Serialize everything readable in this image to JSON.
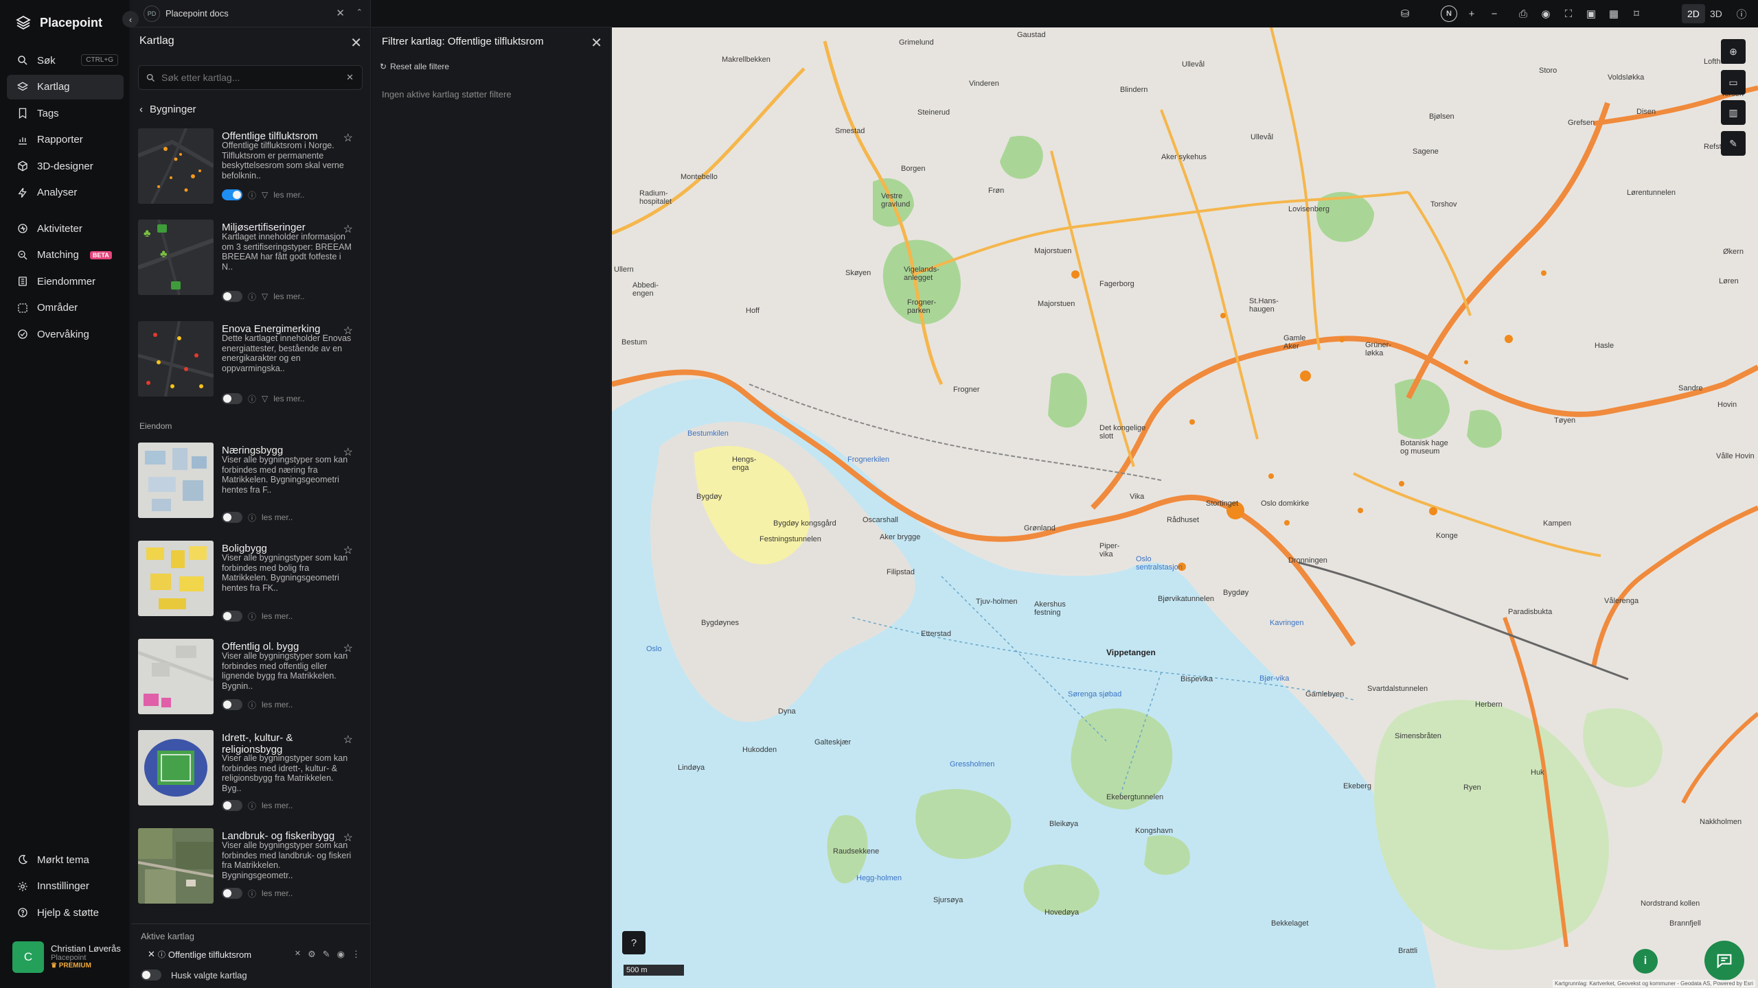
{
  "app": {
    "name": "Placepoint"
  },
  "nav": {
    "items": [
      {
        "label": "Søk",
        "icon": "search-icon",
        "shortcut": "CTRL+G"
      },
      {
        "label": "Kartlag",
        "icon": "layers-icon",
        "active": true
      },
      {
        "label": "Tags",
        "icon": "bookmark-icon"
      },
      {
        "label": "Rapporter",
        "icon": "bar-chart-icon"
      },
      {
        "label": "3D-designer",
        "icon": "cube-icon"
      },
      {
        "label": "Analyser",
        "icon": "bolt-icon"
      }
    ],
    "items2": [
      {
        "label": "Aktiviteter",
        "icon": "activity-icon"
      },
      {
        "label": "Matching",
        "icon": "match-icon",
        "badge": "BETA"
      },
      {
        "label": "Eiendommer",
        "icon": "building-icon"
      },
      {
        "label": "Områder",
        "icon": "area-icon"
      },
      {
        "label": "Overvåking",
        "icon": "monitor-icon"
      }
    ],
    "bottom": [
      {
        "label": "Mørkt tema",
        "icon": "moon-icon"
      },
      {
        "label": "Innstillinger",
        "icon": "gear-icon"
      },
      {
        "label": "Hjelp & støtte",
        "icon": "help-icon"
      }
    ]
  },
  "user": {
    "initial": "C",
    "name": "Christian Løverås",
    "org": "Placepoint",
    "plan": "PREMIUM"
  },
  "doc": {
    "badge": "PD",
    "name": "Placepoint docs"
  },
  "layers": {
    "title": "Kartlag",
    "search_placeholder": "Søk etter kartlag...",
    "back_label": "Bygninger",
    "section_eiendom": "Eiendom",
    "more_label": "les mer..",
    "cards": [
      {
        "title": "Offentlige tilfluktsrom",
        "desc": "Offentlige tilfluktsrom i Norge. Tilfluktsrom er permanente beskyttelsesrom som skal verne befolknin..",
        "enabled": true
      },
      {
        "title": "Miljøsertifiseringer",
        "desc": "Kartlaget inneholder informasjon om 3 sertifiseringstyper: BREEAM BREEAM har fått godt fotfeste i N..",
        "enabled": false
      },
      {
        "title": "Enova Energimerking",
        "desc": "Dette kartlaget inneholder Enovas energiattester, bestående av en energikarakter og en oppvarmingska..",
        "enabled": false
      },
      {
        "title": "Næringsbygg",
        "desc": "Viser alle bygningstyper som kan forbindes med næring fra Matrikkelen. Bygningsgeometri hentes fra F..",
        "enabled": false
      },
      {
        "title": "Boligbygg",
        "desc": "Viser alle bygningstyper som kan forbindes med bolig fra Matrikkelen. Bygningsgeometri hentes fra FK..",
        "enabled": false
      },
      {
        "title": "Offentlig ol. bygg",
        "desc": "Viser alle bygningstyper som kan forbindes med offentlig eller lignende bygg fra Matrikkelen. Bygnin..",
        "enabled": false
      },
      {
        "title": "Idrett-, kultur- & religionsbygg",
        "desc": "Viser alle bygningstyper som kan forbindes med idrett-, kultur- & religionsbygg fra Matrikkelen. Byg..",
        "enabled": false
      },
      {
        "title": "Landbruk- og fiskeribygg",
        "desc": "Viser alle bygningstyper som kan forbindes med landbruk- og fiskeri fra Matrikkelen. Bygningsgeometr..",
        "enabled": false
      }
    ],
    "active_title": "Aktive kartlag",
    "active_layer": "Offentlige tilfluktsrom",
    "remember_label": "Husk valgte kartlag"
  },
  "filter": {
    "title": "Filtrer kartlag: Offentlige tilfluktsrom",
    "reset_label": "Reset alle filtere",
    "empty_text": "Ingen aktive kartlag støtter filtere"
  },
  "toolbar": {
    "compass": "N",
    "mode_2d": "2D",
    "mode_3d": "3D",
    "active_mode": "2D"
  },
  "map": {
    "scale": "500 m",
    "attribution": "Kartgrunnlag: Kartverket, Geovekst og kommuner - Geodata AS, Powered by Esri",
    "labels": [
      "Grimelund",
      "Gaustad",
      "Makrellbekken",
      "Ullevål",
      "Voldsløkka",
      "Lofthus",
      "Storo",
      "Vinderen",
      "Blindern",
      "Steinerud",
      "Smestad",
      "Ullevål",
      "Bjølsen",
      "Disen",
      "Torsen",
      "Grefsen",
      "Sagene",
      "Refstad",
      "Borgen",
      "Aker sykehus",
      "Vestre gravlund",
      "Frøn",
      "Montebello",
      "Radium-hospitalet",
      "Lovisenberg",
      "Torshov",
      "Lørentunnelen",
      "Ullern",
      "Majorstuen",
      "Vigelands-anlegget",
      "Fagerborg",
      "Abbedi-engen",
      "Skøyen",
      "Frogner-parken",
      "Majorstuen",
      "St.Hans-haugen",
      "Gamle Aker",
      "Grüner-løkka",
      "Økern",
      "Hoff",
      "Løren",
      "Bestum",
      "Hasle",
      "Frogner",
      "Sandre",
      "Det kongelige slott",
      "Tøyen",
      "Hovin",
      "Bestumkilen",
      "Hengs-enga",
      "Frognerkilen",
      "Botanisk hage og museum",
      "Vålle Hovin",
      "Bygdøy",
      "Vika",
      "Rådhuset",
      "Stortinget",
      "Oslo domkirke",
      "Kampen",
      "Oscarshall",
      "Bygdøy kongsgård",
      "Festningstunnelen",
      "Grønland",
      "Konge",
      "Aker brygge",
      "Piper-vika",
      "Oslo sentralstasjon",
      "Dronningen",
      "Filipstad",
      "Tjuv-holmen",
      "Akershus festning",
      "Bjørvikatunnelen",
      "Bygdøy",
      "Bygdøynes",
      "Etterstad",
      "Vålerenga",
      "Paradisbukta",
      "Oslo",
      "Vippetangen",
      "Bispevika",
      "Bjør-vika",
      "Kavringen",
      "Sørenga sjøbad",
      "Gamlebyen",
      "Svartdalstunnelen",
      "Herbern",
      "Dyna",
      "Galteskjær",
      "Gressholmen",
      "Hovedøya",
      "Ekebergtunnelen",
      "Simensbråten",
      "Huk",
      "Hukodden",
      "Lindøya",
      "Bleikøya",
      "Kongshavn",
      "Ekeberg",
      "Ryen",
      "Nakkholmen",
      "Raudsekkene",
      "Hegg-holmen",
      "Sjursøya",
      "Bekkelaget",
      "Brattli",
      "Nordstrand kollen",
      "Brannfjell"
    ]
  }
}
